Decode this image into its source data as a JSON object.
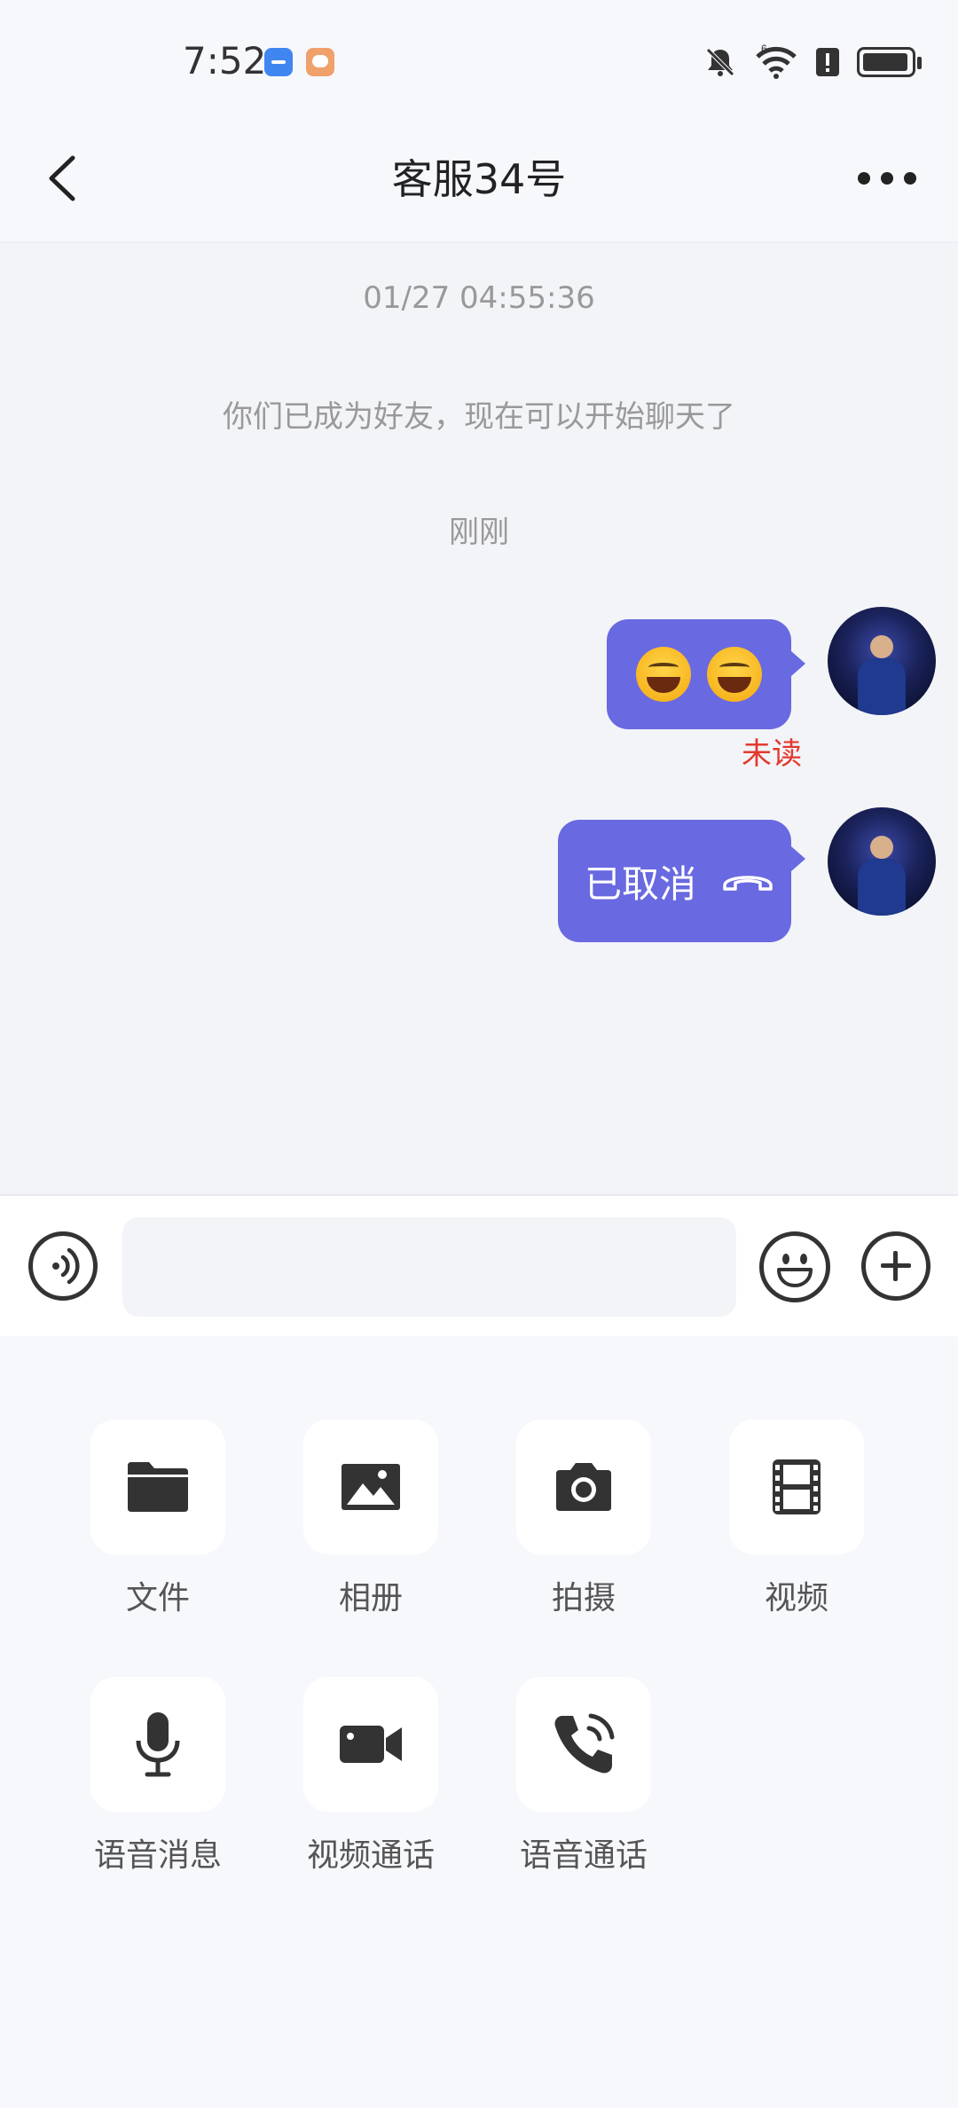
{
  "status": {
    "time": "7:52",
    "signal_label": "6"
  },
  "header": {
    "title": "客服34号"
  },
  "chat": {
    "timestamp": "01/27 04:55:36",
    "system_message": "你们已成为好友，现在可以开始聊天了",
    "recent_label": "刚刚",
    "messages": [
      {
        "type": "emoji",
        "emojis": [
          "grinning-squinting-face",
          "grinning-squinting-face"
        ],
        "status": "未读"
      },
      {
        "type": "call",
        "text": "已取消",
        "icon": "hangup-phone-icon"
      }
    ]
  },
  "input": {
    "placeholder": "",
    "value": ""
  },
  "tools": [
    {
      "label": "文件",
      "icon": "folder-icon"
    },
    {
      "label": "相册",
      "icon": "image-icon"
    },
    {
      "label": "拍摄",
      "icon": "camera-icon"
    },
    {
      "label": "视频",
      "icon": "film-icon"
    },
    {
      "label": "语音消息",
      "icon": "microphone-icon"
    },
    {
      "label": "视频通话",
      "icon": "video-camera-icon"
    },
    {
      "label": "语音通话",
      "icon": "phone-call-icon"
    }
  ],
  "colors": {
    "bubble": "#6969e1",
    "unread": "#e23a2e",
    "background": "#f7f8fc"
  }
}
